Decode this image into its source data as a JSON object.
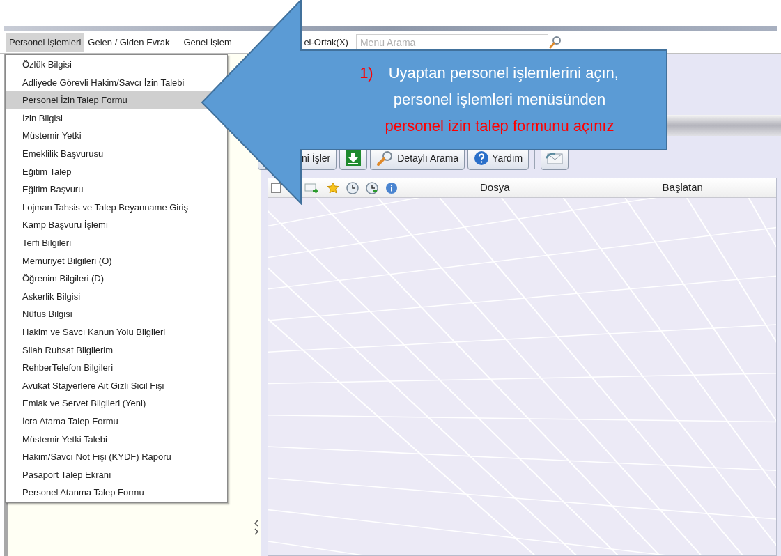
{
  "menu_bar": {
    "items": [
      {
        "label": "Personel İşlemleri",
        "selected": true
      },
      {
        "label": "Gelen / Giden Evrak",
        "selected": false
      },
      {
        "label": "Genel İşlem",
        "selected": false
      },
      {
        "label": "el-Ortak(X)",
        "selected": false
      }
    ],
    "search": {
      "placeholder": "Menu Arama"
    }
  },
  "dropdown": {
    "items": [
      {
        "label": "Özlük Bilgisi",
        "selected": false
      },
      {
        "label": "Adliyede Görevli Hakim/Savcı İzin Talebi",
        "selected": false
      },
      {
        "label": "Personel İzin Talep Formu",
        "selected": true
      },
      {
        "label": "İzin Bilgisi",
        "selected": false
      },
      {
        "label": "Müstemir Yetki",
        "selected": false
      },
      {
        "label": "Emeklilik Başvurusu",
        "selected": false
      },
      {
        "label": "Eğitim Talep",
        "selected": false
      },
      {
        "label": "Eğitim Başvuru",
        "selected": false
      },
      {
        "label": "Lojman Tahsis ve Talep Beyanname Giriş",
        "selected": false
      },
      {
        "label": "Kamp Başvuru İşlemi",
        "selected": false
      },
      {
        "label": "Terfi Bilgileri",
        "selected": false
      },
      {
        "label": "Memuriyet Bilgileri (O)",
        "selected": false
      },
      {
        "label": "Öğrenim Bilgileri (D)",
        "selected": false
      },
      {
        "label": "Askerlik Bilgisi",
        "selected": false
      },
      {
        "label": "Nüfus Bilgisi",
        "selected": false
      },
      {
        "label": "Hakim ve Savcı Kanun Yolu Bilgileri",
        "selected": false
      },
      {
        "label": "Silah Ruhsat Bilgilerim",
        "selected": false
      },
      {
        "label": "RehberTelefon Bilgileri",
        "selected": false
      },
      {
        "label": "Avukat Stajyerlere Ait Gizli Sicil Fişi",
        "selected": false
      },
      {
        "label": "Emlak ve Servet Bilgileri (Yeni)",
        "selected": false
      },
      {
        "label": "İcra Atama Talep Formu",
        "selected": false
      },
      {
        "label": "Müstemir Yetki Talebi",
        "selected": false
      },
      {
        "label": "Hakim/Savcı Not Fişi (KYDF) Raporu",
        "selected": false
      },
      {
        "label": "Pasaport Talep Ekranı",
        "selected": false
      },
      {
        "label": "Personel Atanma Talep Formu",
        "selected": false
      }
    ]
  },
  "toolbar": {
    "buttons": [
      {
        "kind": "text",
        "label": "ni İşler"
      },
      {
        "kind": "download"
      },
      {
        "kind": "search",
        "label": "Detaylı Arama"
      },
      {
        "kind": "help",
        "label": "Yardım"
      },
      {
        "kind": "separator"
      },
      {
        "kind": "mail"
      }
    ]
  },
  "table": {
    "select_all": {
      "checked": false
    },
    "columns": [
      "Dosya",
      "Başlatan"
    ]
  },
  "callout": {
    "number": "1)",
    "lines": [
      {
        "text": "Uyaptan personel işlemlerini açın,",
        "color": "#ffffff"
      },
      {
        "text": "personel işlemleri menüsünden",
        "color": "#ffffff"
      },
      {
        "text": "personel izin talep formunu açınız",
        "color": "#ff0000"
      }
    ]
  }
}
